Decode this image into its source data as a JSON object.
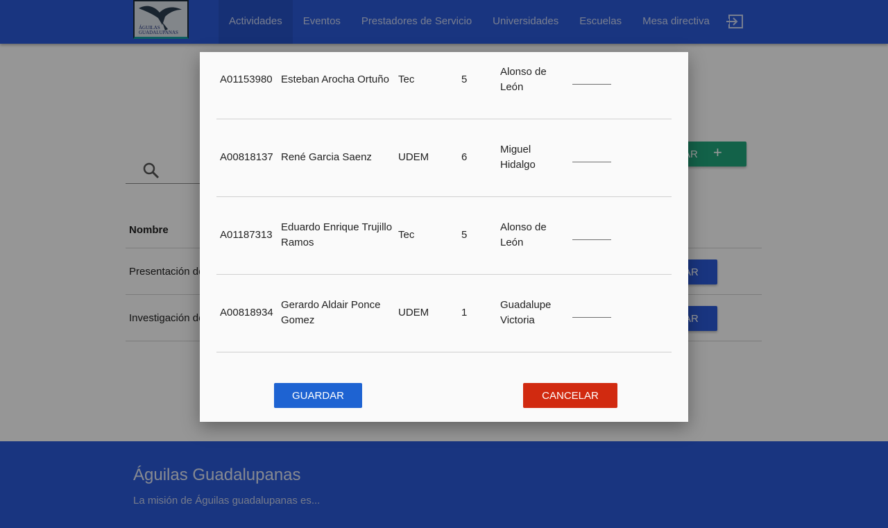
{
  "nav": {
    "items": [
      {
        "label": "Actividades"
      },
      {
        "label": "Eventos"
      },
      {
        "label": "Prestadores de Servicio"
      },
      {
        "label": "Universidades"
      },
      {
        "label": "Escuelas"
      },
      {
        "label": "Mesa directiva"
      }
    ],
    "logout_icon": "logout-icon",
    "logo_text": "ÁGUILAS GUADALUPANAS"
  },
  "page": {
    "search_icon": "search-icon",
    "add_button_label": "AR",
    "add_button_icon": "+",
    "table_header": "Nombre",
    "rows": [
      {
        "name": "Presentación de",
        "button_label": "AR"
      },
      {
        "name": "Investigación de",
        "button_label": "AR"
      }
    ]
  },
  "modal": {
    "rows": [
      {
        "id": "A01153980",
        "name": "Esteban Arocha Ortuño",
        "university": "Tec",
        "number": "5",
        "location": "Alonso de León",
        "input": ""
      },
      {
        "id": "A00818137",
        "name": "René Garcia Saenz",
        "university": "UDEM",
        "number": "6",
        "location": "Miguel Hidalgo",
        "input": ""
      },
      {
        "id": "A01187313",
        "name": "Eduardo Enrique Trujillo Ramos",
        "university": "Tec",
        "number": "5",
        "location": "Alonso de León",
        "input": ""
      },
      {
        "id": "A00818934",
        "name": "Gerardo Aldair Ponce Gomez",
        "university": "UDEM",
        "number": "1",
        "location": "Guadalupe Victoria",
        "input": ""
      }
    ],
    "save_label": "GUARDAR",
    "cancel_label": "CANCELAR"
  },
  "footer": {
    "title": "Águilas Guadalupanas",
    "text": "La misión de Águilas guadalupanas es..."
  },
  "colors": {
    "primary": "#2b59d6",
    "accent_green": "#21a37b",
    "save": "#1e63d2",
    "cancel": "#d12a10"
  }
}
